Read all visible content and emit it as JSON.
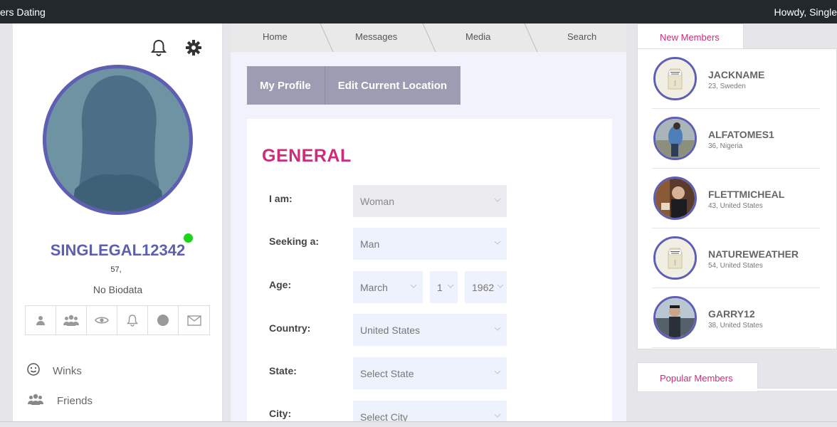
{
  "topbar": {
    "site_title": "ers Dating",
    "greeting": "Howdy, Single"
  },
  "profile": {
    "username": "SINGLEGAL12342",
    "age": "57,",
    "bio": "No Biodata",
    "online_color": "#1ed31e",
    "header_icons": [
      "bell-icon",
      "gear-icon"
    ],
    "action_icons": [
      "user-icon",
      "group-icon",
      "eye-icon",
      "bell-icon",
      "circle-icon",
      "envelope-icon"
    ],
    "menu": [
      {
        "icon": "smiley-icon",
        "label": "Winks"
      },
      {
        "icon": "group-icon",
        "label": "Friends"
      }
    ]
  },
  "nav": {
    "items": [
      "Home",
      "Messages",
      "Media",
      "Search"
    ]
  },
  "buttons": {
    "my_profile": "My Profile",
    "edit_location": "Edit Current Location"
  },
  "form": {
    "title": "GENERAL",
    "fields": [
      {
        "label": "I am:",
        "value": "Woman"
      },
      {
        "label": "Seeking a:",
        "value": "Man"
      },
      {
        "label": "Age:",
        "month": "March",
        "day": "1",
        "year": "1962"
      },
      {
        "label": "Country:",
        "value": "United States"
      },
      {
        "label": "State:",
        "value": "Select State"
      },
      {
        "label": "City:",
        "value": "Select City"
      }
    ]
  },
  "sidebar": {
    "new_tab": "New Members",
    "popular_tab": "Popular Members",
    "members": [
      {
        "name": "JACKNAME",
        "location": "23, Sweden",
        "avatar": "private-photo"
      },
      {
        "name": "ALFATOMES1",
        "location": "36, Nigeria",
        "avatar": "photo"
      },
      {
        "name": "FLETTMICHEAL",
        "location": "43, United States",
        "avatar": "photo"
      },
      {
        "name": "NATUREWEATHER",
        "location": "54, United States",
        "avatar": "private-photo"
      },
      {
        "name": "GARRY12",
        "location": "38, United States",
        "avatar": "photo"
      }
    ]
  },
  "colors": {
    "accent": "#cc2c7b",
    "brand": "#5e5fb3",
    "button": "#9c9cb3"
  }
}
